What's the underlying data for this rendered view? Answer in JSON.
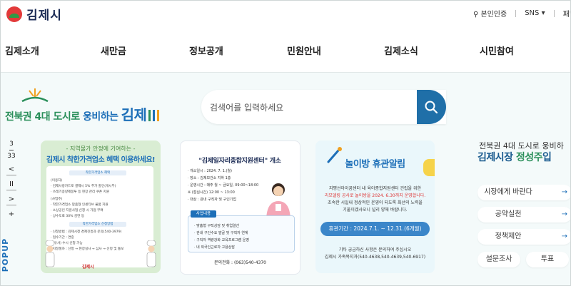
{
  "header": {
    "logo_text": "김제시",
    "cert_label": "본인인증",
    "sns_label": "SNS",
    "sitemap_label": "패밀"
  },
  "nav": [
    "김제소개",
    "새만금",
    "정보공개",
    "민원안내",
    "김제소식",
    "시민참여"
  ],
  "hero": {
    "slogan_prefix": "전북권 4대 도시로 ",
    "slogan_mid": "웅비하는",
    "slogan_city": "김제",
    "search_placeholder": "검색어를 입력하세요"
  },
  "popup": {
    "current": "3",
    "total": "33",
    "label": "POPUP",
    "prev_label": "<",
    "pause_label": "II",
    "next_label": ">",
    "plus_label": "+"
  },
  "card1": {
    "subtitle": "- 지역물가 안정에 기여하는 -",
    "title": "김제시 착한가격업소 혜택 이용하세요!",
    "lines": [
      "착한가격업소 혜택",
      "(이용자)",
      "· 김제사랑카드로 결제시 5% 추가 할인(개시부)",
      "· 쓰레기종량제봉투 등 현장 관리 쿠폰 지원",
      "(사업주)",
      "· 착한가격업소 맞춤형 인센티브 물품 지원",
      "· 소상공인 지원사업 신청 시 가점 부여",
      "· 상수도료 30% 감면 등",
      "착한가격업소 신청방법",
      "· 신청방법 : 김제시청 경제진흥과 문의(540-3979)",
      "· 접수기간 : 연중",
      "· (유사) 수시 신청 가능",
      "· 지정절차 : 신청 → 현장실사 → 심사 → 선정 및 통보"
    ],
    "footer": "김제시"
  },
  "card2": {
    "title": "\"김제일자리종합지원센터\" 개소",
    "lines": [
      "· 개소일시 : 2024. 7. 1.(월)",
      "· 장소 : 김제보건소 지하 1층",
      "· 운영시간 : 매주 월 ~ 금요일, 09:00~18:00",
      "  ※ (점심시간) 12:00 ~ 13:00",
      "· 대상 : 관내 구직자 및 구인기업"
    ],
    "badge": "사업내용",
    "box_lines": [
      "· 맞춤형 구직상담 및 취업알선",
      "· 관내 구인수요 발굴 및 구직자 연계",
      "· 구직자 역량강화 교육프로그램 운영",
      "· 내 외국인근로자 고용상담"
    ],
    "contact": "문의전화 : (063)540-4370"
  },
  "card3": {
    "title": "놀이방 휴관알림",
    "lines": [
      "지평선아이꿈센터 내 육아종합지원센터 건립을 위한",
      "리모델링 공사로 놀이방을 2024. 6.30까지 운영합니다.",
      "조속한 시일내 정상적인 운영이 되도록 최선의 노력을",
      "기울이겠사오니 널리 양해 바랍니다."
    ],
    "period": "휴관기간 : 2024.7.1. ~ 12.31.(6개월)",
    "footer_lines": [
      "기타 궁금하신 사항은 문의하여 주십시오",
      "김제시 가족복지과(540-4638,540-4639,540-6917)"
    ]
  },
  "right_panel": {
    "subtitle": "전북권 4대 도시로 웅비하",
    "title_prefix": "김제시장 ",
    "title_accent": "정성주",
    "title_suffix": "입",
    "buttons": [
      "시장에게 바란다",
      "공약실천",
      "정책제안"
    ],
    "small_buttons": [
      "설문조사",
      "투표"
    ],
    "arrow": "→"
  }
}
